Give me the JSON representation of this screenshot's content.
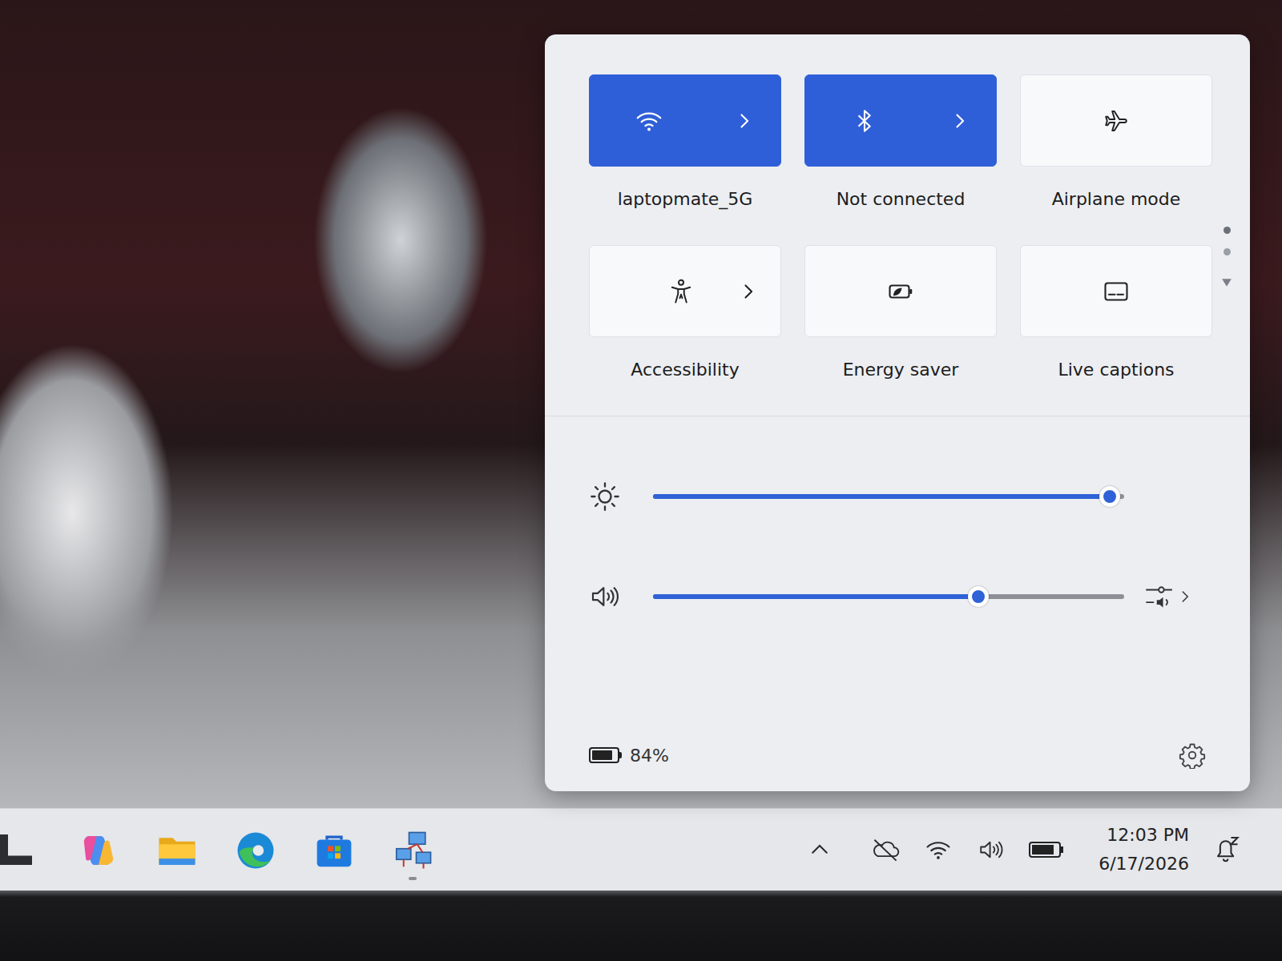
{
  "quick_settings": {
    "tiles": [
      {
        "label": "laptopmate_5G",
        "kind": "wifi",
        "on": true,
        "expandable": true
      },
      {
        "label": "Not connected",
        "kind": "bluetooth",
        "on": true,
        "expandable": true
      },
      {
        "label": "Airplane mode",
        "kind": "airplane",
        "on": false,
        "expandable": false
      },
      {
        "label": "Accessibility",
        "kind": "accessibility",
        "on": false,
        "expandable": true
      },
      {
        "label": "Energy saver",
        "kind": "energy",
        "on": false,
        "expandable": false
      },
      {
        "label": "Live captions",
        "kind": "captions",
        "on": false,
        "expandable": false
      }
    ],
    "pages": [
      {
        "selected": true
      },
      {
        "selected": false
      }
    ],
    "sliders": [
      {
        "kind": "brightness",
        "level": 0.97
      },
      {
        "kind": "volume",
        "level": 0.69
      }
    ],
    "battery": {
      "reading": "84%",
      "level": 0.84
    }
  },
  "taskbar": {
    "apps": [
      {
        "kind": "copilot",
        "running": false
      },
      {
        "kind": "explorer",
        "running": false
      },
      {
        "kind": "edge",
        "running": false
      },
      {
        "kind": "store",
        "running": false
      },
      {
        "kind": "network",
        "running": true
      }
    ],
    "tray": {
      "time": "12:03 PM",
      "date": "6/17/2026"
    }
  }
}
